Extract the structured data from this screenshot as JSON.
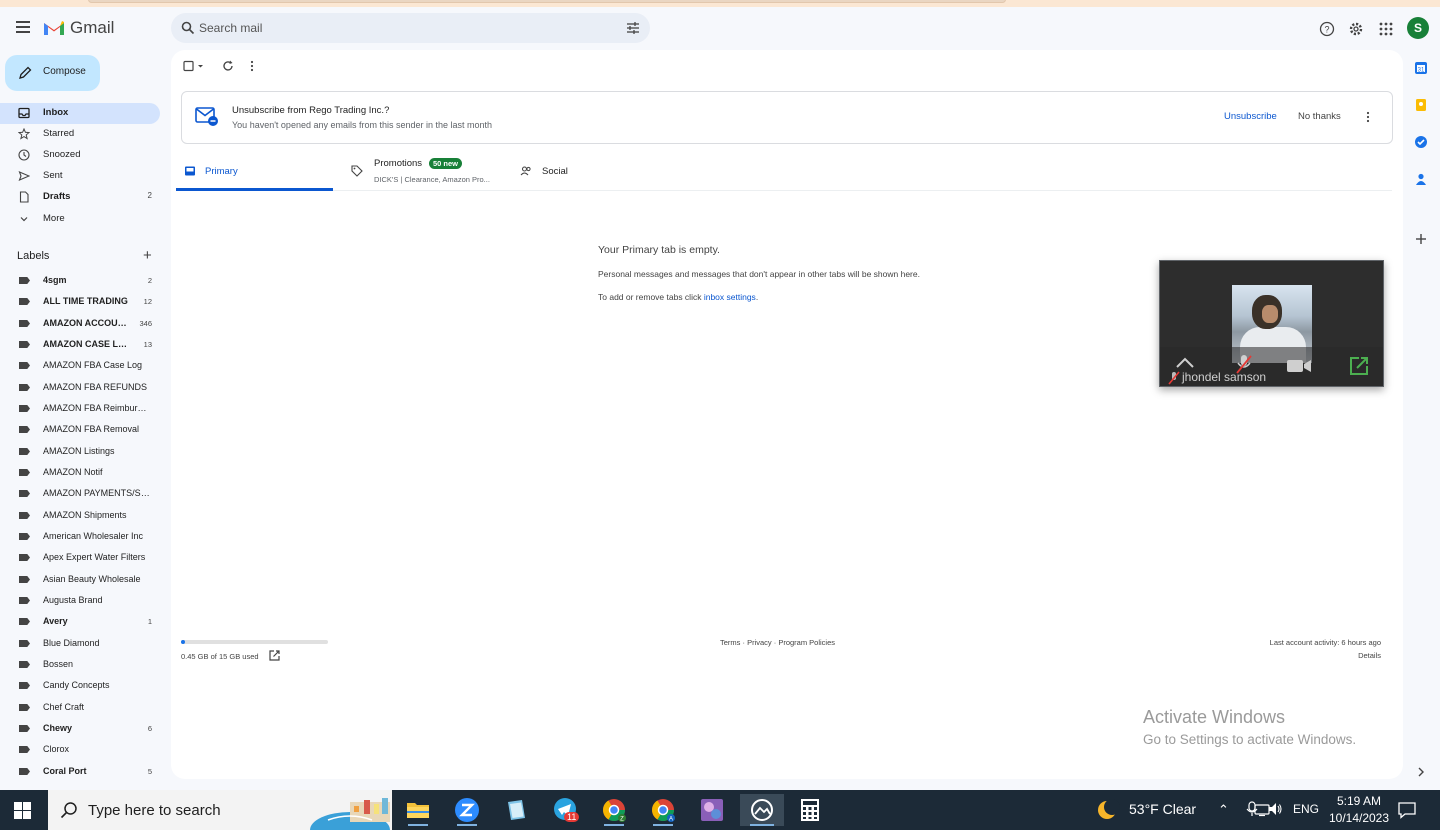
{
  "app": {
    "brand": "Gmail"
  },
  "search": {
    "placeholder": "Search mail"
  },
  "header": {
    "avatar_letter": "S"
  },
  "compose": {
    "label": "Compose"
  },
  "nav": [
    {
      "label": "Inbox",
      "count": "",
      "icon": "inbox-icon"
    },
    {
      "label": "Starred",
      "count": "",
      "icon": "star-icon"
    },
    {
      "label": "Snoozed",
      "count": "",
      "icon": "clock-icon"
    },
    {
      "label": "Sent",
      "count": "",
      "icon": "send-icon"
    },
    {
      "label": "Drafts",
      "count": "2",
      "icon": "draft-icon"
    },
    {
      "label": "More",
      "count": "",
      "icon": "chevron-down-icon"
    }
  ],
  "labels": {
    "heading": "Labels",
    "items": [
      {
        "label": "4sgm",
        "count": "2"
      },
      {
        "label": "ALL TIME TRADING",
        "count": "12"
      },
      {
        "label": "AMAZON ACCOUNT",
        "count": "346"
      },
      {
        "label": "AMAZON CASE LOG",
        "count": "13"
      },
      {
        "label": "AMAZON FBA Case Log",
        "count": ""
      },
      {
        "label": "AMAZON FBA REFUNDS",
        "count": ""
      },
      {
        "label": "AMAZON FBA Reimbursements",
        "count": ""
      },
      {
        "label": "AMAZON FBA Removal",
        "count": ""
      },
      {
        "label": "AMAZON Listings",
        "count": ""
      },
      {
        "label": "AMAZON Notif",
        "count": ""
      },
      {
        "label": "AMAZON PAYMENTS/SETTLEMENTS",
        "count": ""
      },
      {
        "label": "AMAZON Shipments",
        "count": ""
      },
      {
        "label": "American Wholesaler Inc",
        "count": ""
      },
      {
        "label": "Apex Expert Water Filters",
        "count": ""
      },
      {
        "label": "Asian Beauty Wholesale",
        "count": ""
      },
      {
        "label": "Augusta Brand",
        "count": ""
      },
      {
        "label": "Avery",
        "count": "1"
      },
      {
        "label": "Blue Diamond",
        "count": ""
      },
      {
        "label": "Bossen",
        "count": ""
      },
      {
        "label": "Candy Concepts",
        "count": ""
      },
      {
        "label": "Chef Craft",
        "count": ""
      },
      {
        "label": "Chewy",
        "count": "6"
      },
      {
        "label": "Clorox",
        "count": ""
      },
      {
        "label": "Coral Port",
        "count": "5"
      }
    ]
  },
  "unsubscribe_banner": {
    "title": "Unsubscribe from Rego Trading Inc.?",
    "subtitle": "You haven't opened any emails from this sender in the last month",
    "unsubscribe": "Unsubscribe",
    "no_thanks": "No thanks"
  },
  "tabs": {
    "primary": "Primary",
    "promotions": "Promotions",
    "promotions_badge": "50 new",
    "promotions_sub": "DICK'S | Clearance, Amazon Pro...",
    "social": "Social"
  },
  "empty_state": {
    "title": "Your Primary tab is empty.",
    "description": "Personal messages and messages that don't appear in other tabs will be shown here.",
    "tabs_prefix": "To add or remove tabs click ",
    "tabs_link": "inbox settings",
    "tabs_suffix": "."
  },
  "video_call": {
    "participant": "jhondel samson"
  },
  "footer": {
    "storage": "0.45 GB of 15 GB used",
    "storage_fraction": 0.03,
    "links": "Terms · Privacy · Program Policies",
    "last_activity": "Last account activity: 6 hours ago",
    "details": "Details"
  },
  "watermark": {
    "line1": "Activate Windows",
    "line2": "Go to Settings to activate Windows."
  },
  "taskbar": {
    "search_placeholder": "Type here to search",
    "weather": "53°F  Clear",
    "language": "ENG",
    "time": "5:19 AM",
    "date": "10/14/2023",
    "telegram_badge": "11"
  }
}
